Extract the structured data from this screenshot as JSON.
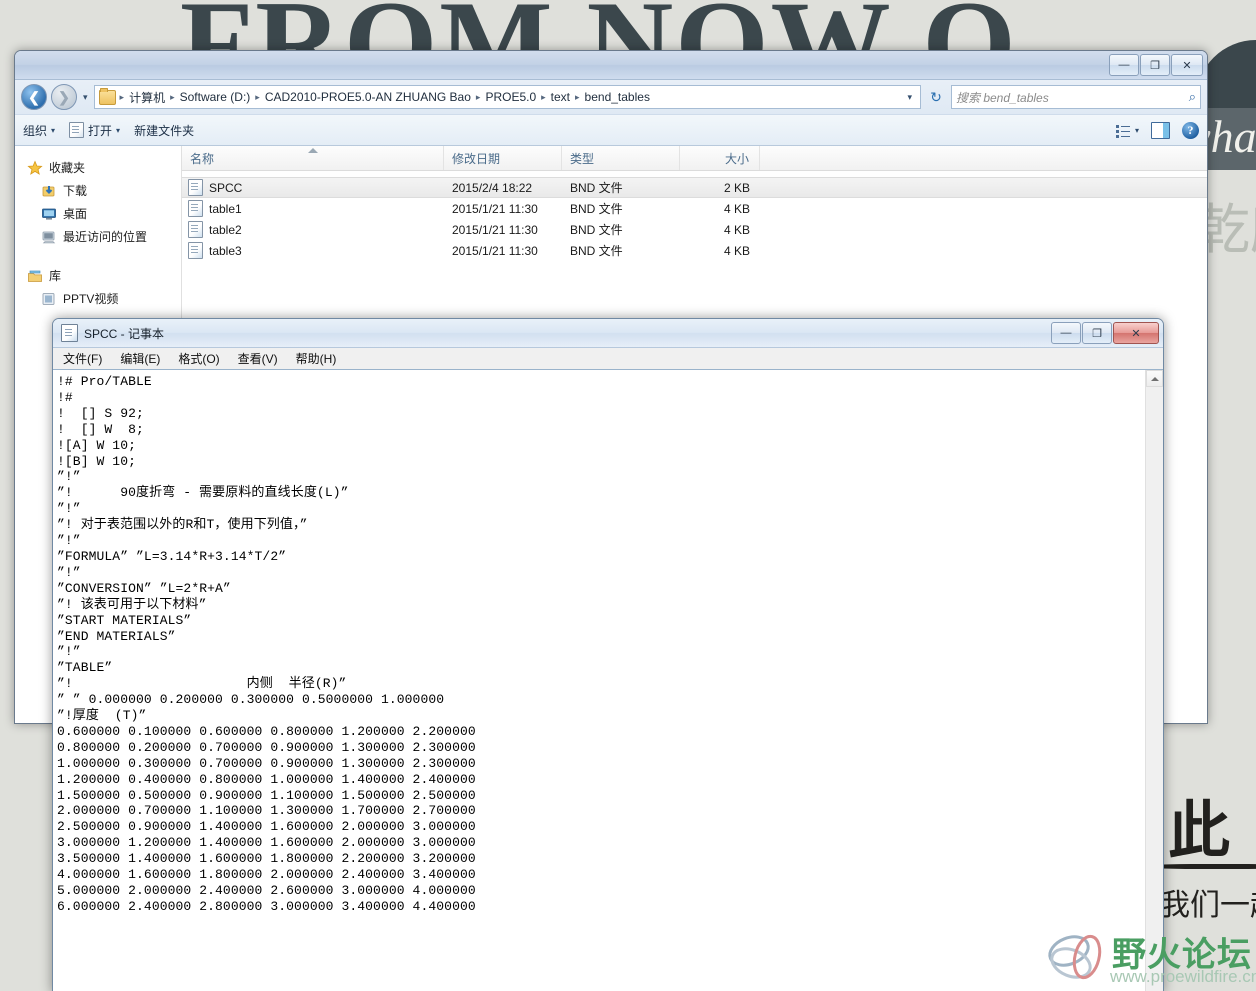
{
  "wallpaper": {
    "headline": "FROM NOW O",
    "band_text": "wha",
    "cn_text_1": "乾所",
    "cn_text_2": "此",
    "cn_text_3": "我们一起"
  },
  "watermark": {
    "title": "野火论坛",
    "url": "www.proewildfire.cn"
  },
  "explorer": {
    "window_buttons": {
      "minimize": "—",
      "maximize": "❐",
      "close": "✕"
    },
    "address": {
      "crumbs": [
        "计算机",
        "Software (D:)",
        "CAD2010-PROE5.0-AN ZHUANG Bao",
        "PROE5.0",
        "text",
        "bend_tables"
      ],
      "separator": "▸",
      "dropdown_caret": "▾",
      "refresh_icon": "↻"
    },
    "search": {
      "placeholder": "搜索 bend_tables",
      "icon": "⌕"
    },
    "toolbar": {
      "organize": "组织",
      "open": "打开",
      "new_folder": "新建文件夹",
      "caret": "▾",
      "help_label": "?"
    },
    "nav_pane": {
      "groups": [
        {
          "head": "收藏夹",
          "head_icon": "star-icon",
          "children": [
            {
              "label": "下载",
              "icon": "downloads-icon"
            },
            {
              "label": "桌面",
              "icon": "desktop-icon"
            },
            {
              "label": "最近访问的位置",
              "icon": "recent-places-icon"
            }
          ]
        },
        {
          "head": "库",
          "head_icon": "library-icon",
          "children": [
            {
              "label": "PPTV视频",
              "icon": "video-library-icon"
            }
          ]
        }
      ]
    },
    "list": {
      "columns": [
        "名称",
        "修改日期",
        "类型",
        "大小"
      ],
      "rows": [
        {
          "name": "SPCC",
          "date": "2015/2/4 18:22",
          "type": "BND 文件",
          "size": "2 KB",
          "selected": true
        },
        {
          "name": "table1",
          "date": "2015/1/21 11:30",
          "type": "BND 文件",
          "size": "4 KB",
          "selected": false
        },
        {
          "name": "table2",
          "date": "2015/1/21 11:30",
          "type": "BND 文件",
          "size": "4 KB",
          "selected": false
        },
        {
          "name": "table3",
          "date": "2015/1/21 11:30",
          "type": "BND 文件",
          "size": "4 KB",
          "selected": false
        }
      ]
    }
  },
  "notepad": {
    "title": "SPCC - 记事本",
    "menu": [
      "文件(F)",
      "编辑(E)",
      "格式(O)",
      "查看(V)",
      "帮助(H)"
    ],
    "window_buttons": {
      "minimize": "—",
      "maximize": "❐",
      "close": "✕"
    },
    "scroll_up_icon": "▲",
    "content": "!# Pro/TABLE\n!#\n!  [] S 92;\n!  [] W  8;\n![A] W 10;\n![B] W 10;\n”!”\n”!      90度折弯 - 需要原料的直线长度(L)”\n”!”\n”! 对于表范围以外的R和T，使用下列值，”\n”!”\n”FORMULA” ”L=3.14*R+3.14*T/2”\n”!”\n”CONVERSION” ”L=2*R+A”\n”! 该表可用于以下材料”\n”START MATERIALS”\n”END MATERIALS”\n”!”\n”TABLE”\n”!                      内侧  半径(R)”\n” ” 0.000000 0.200000 0.300000 0.5000000 1.000000\n”!厚度  (T)”\n0.600000 0.100000 0.600000 0.800000 1.200000 2.200000\n0.800000 0.200000 0.700000 0.900000 1.300000 2.300000\n1.000000 0.300000 0.700000 0.900000 1.300000 2.300000\n1.200000 0.400000 0.800000 1.000000 1.400000 2.400000\n1.500000 0.500000 0.900000 1.100000 1.500000 2.500000\n2.000000 0.700000 1.100000 1.300000 1.700000 2.700000\n2.500000 0.900000 1.400000 1.600000 2.000000 3.000000\n3.000000 1.200000 1.400000 1.600000 2.000000 3.000000\n3.500000 1.400000 1.600000 1.800000 2.200000 3.200000\n4.000000 1.600000 1.800000 2.000000 2.400000 3.400000\n5.000000 2.000000 2.400000 2.600000 3.000000 4.000000\n6.000000 2.400000 2.800000 3.000000 3.400000 4.400000"
  }
}
